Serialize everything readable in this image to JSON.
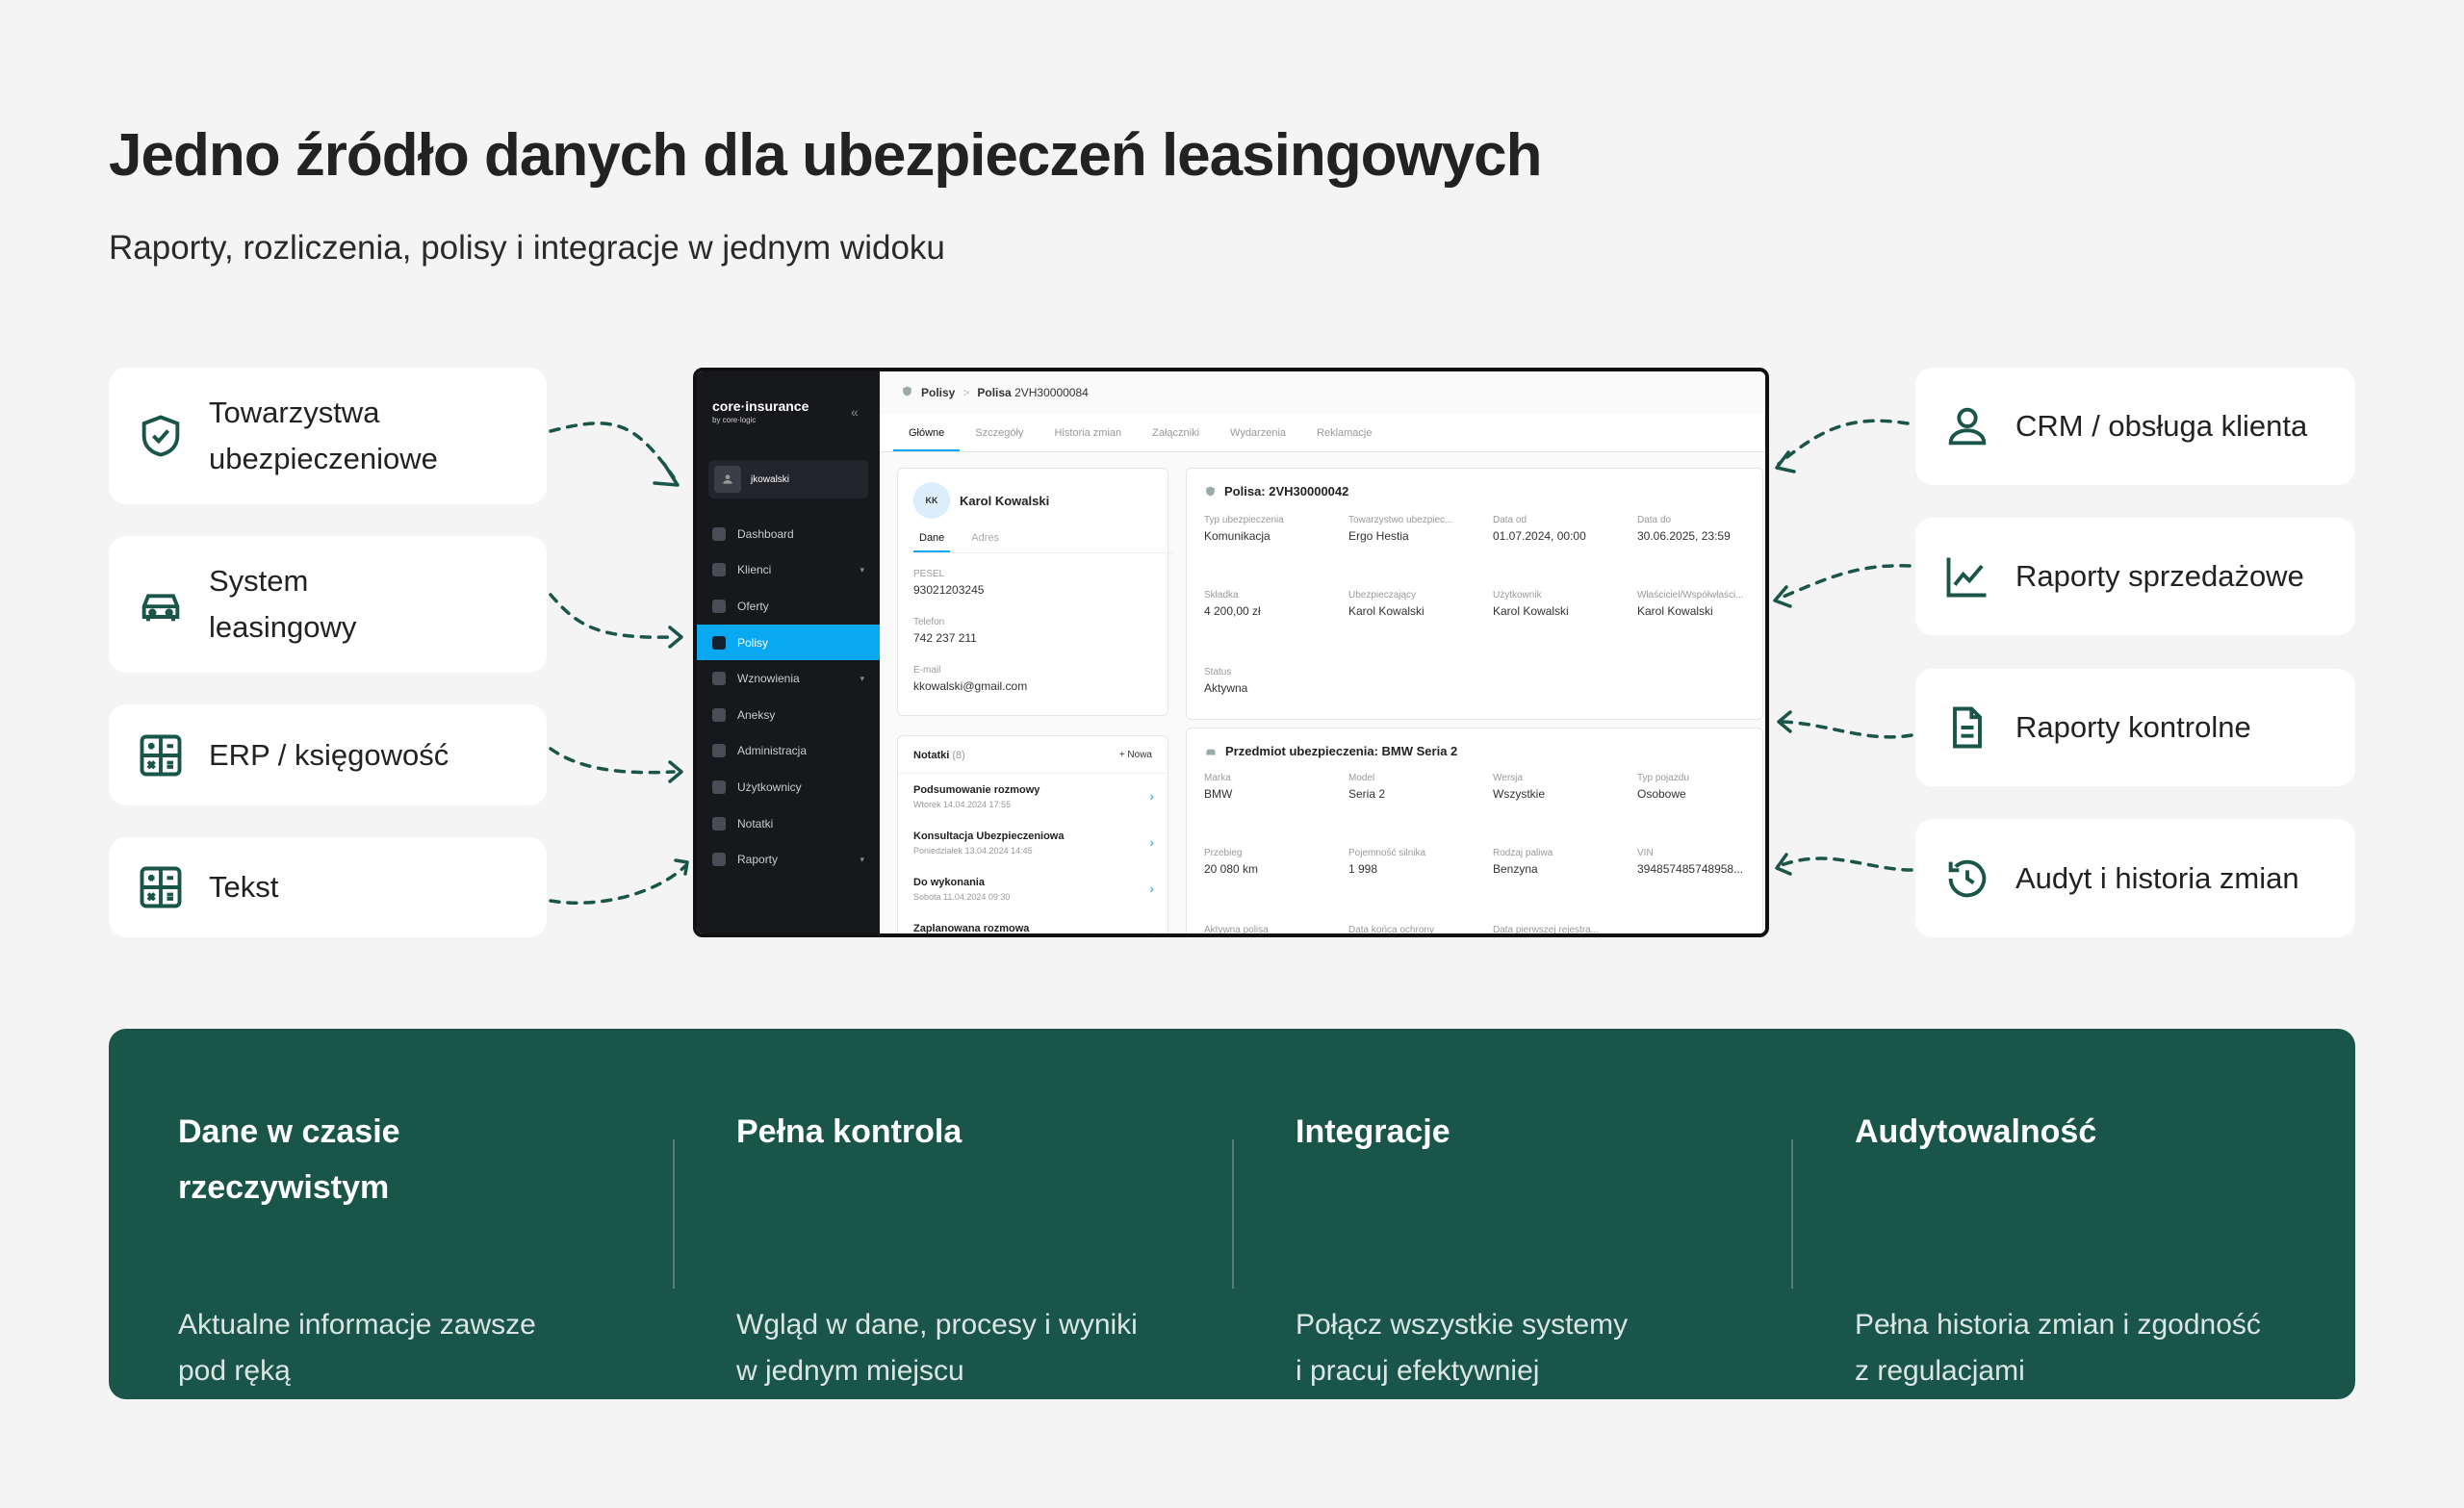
{
  "header": {
    "title": "Jedno źródło danych dla ubezpieczeń leasingowych",
    "subtitle": "Raporty, rozliczenia, polisy i integracje w jednym widoku"
  },
  "left_cards": [
    {
      "label": "Towarzystwa\nubezpieczeniowe",
      "icon": "shield-check-icon"
    },
    {
      "label": "System\nleasingowy",
      "icon": "car-icon"
    },
    {
      "label": "ERP / księgowość",
      "icon": "calculator-icon"
    },
    {
      "label": "Tekst",
      "icon": "calculator-icon"
    }
  ],
  "right_cards": [
    {
      "label": "CRM / obsługa klienta",
      "icon": "user-icon"
    },
    {
      "label": "Raporty sprzedażowe",
      "icon": "line-chart-icon"
    },
    {
      "label": "Raporty kontrolne",
      "icon": "document-icon"
    },
    {
      "label": "Audyt i historia zmian",
      "icon": "history-icon"
    }
  ],
  "app": {
    "brand": "core·insurance",
    "brand_sub": "by core·logic",
    "collapse": "«",
    "username": "jkowalski",
    "nav": [
      {
        "label": "Dashboard",
        "chevron": ""
      },
      {
        "label": "Klienci",
        "chevron": "▾"
      },
      {
        "label": "Oferty",
        "chevron": ""
      },
      {
        "label": "Polisy",
        "chevron": ""
      },
      {
        "label": "Wznowienia",
        "chevron": "▾"
      },
      {
        "label": "Aneksy",
        "chevron": ""
      },
      {
        "label": "Administracja",
        "chevron": ""
      },
      {
        "label": "Użytkownicy",
        "chevron": ""
      },
      {
        "label": "Notatki",
        "chevron": ""
      },
      {
        "label": "Raporty",
        "chevron": "▾"
      }
    ],
    "active_nav": "Polisy",
    "breadcrumb": {
      "root": "Polisy",
      "sep": ">",
      "current_label": "Polisa",
      "current_value": "2VH30000084"
    },
    "tabs": [
      "Główne",
      "Szczegóły",
      "Historia zmian",
      "Załączniki",
      "Wydarzenia",
      "Reklamacje"
    ],
    "client": {
      "initials": "KK",
      "name": "Karol Kowalski",
      "subtabs": [
        "Dane",
        "Adres"
      ],
      "fields": [
        {
          "label": "PESEL",
          "value": "93021203245"
        },
        {
          "label": "Telefon",
          "value": "742 237 211"
        },
        {
          "label": "E-mail",
          "value": "kkowalski@gmail.com"
        }
      ]
    },
    "notes": {
      "title": "Notatki",
      "count": "(8)",
      "new_label": "+ Nowa",
      "items": [
        {
          "title": "Podsumowanie rozmowy",
          "date": "Wtorek 14.04.2024 17:55"
        },
        {
          "title": "Konsultacja Ubezpieczeniowa",
          "date": "Poniedziałek 13.04.2024 14:45"
        },
        {
          "title": "Do wykonania",
          "date": "Sobota 11.04.2024 09:30"
        },
        {
          "title": "Zaplanowana rozmowa",
          "date": ""
        }
      ]
    },
    "policy": {
      "title": "Polisa: 2VH30000042",
      "rows": [
        [
          {
            "label": "Typ ubezpieczenia",
            "value": "Komunikacja"
          },
          {
            "label": "Towarzystwo ubezpiec...",
            "value": "Ergo Hestia"
          },
          {
            "label": "Data od",
            "value": "01.07.2024, 00:00"
          },
          {
            "label": "Data do",
            "value": "30.06.2025, 23:59"
          }
        ],
        [
          {
            "label": "Składka",
            "value": "4 200,00 zł"
          },
          {
            "label": "Ubezpieczający",
            "value": "Karol Kowalski"
          },
          {
            "label": "Użytkownik",
            "value": "Karol Kowalski"
          },
          {
            "label": "Właściciel/Współwłaści...",
            "value": "Karol Kowalski"
          }
        ],
        [
          {
            "label": "Status",
            "value": "Aktywna"
          }
        ]
      ]
    },
    "subject": {
      "title": "Przedmiot ubezpieczenia: BMW Seria 2",
      "rows": [
        [
          {
            "label": "Marka",
            "value": "BMW"
          },
          {
            "label": "Model",
            "value": "Seria 2"
          },
          {
            "label": "Wersja",
            "value": "Wszystkie"
          },
          {
            "label": "Typ pojazdu",
            "value": "Osobowe"
          }
        ],
        [
          {
            "label": "Przebieg",
            "value": "20 080 km"
          },
          {
            "label": "Pojemność silnika",
            "value": "1 998"
          },
          {
            "label": "Rodzaj paliwa",
            "value": "Benzyna"
          },
          {
            "label": "VIN",
            "value": "394857485748958..."
          }
        ],
        [
          {
            "label": "Aktywna polisa",
            "value": ""
          },
          {
            "label": "Data końca ochrony",
            "value": ""
          },
          {
            "label": "Data pierwszej rejestra...",
            "value": ""
          }
        ]
      ]
    }
  },
  "features": [
    {
      "title": "Dane w czasie\nrzeczywistym",
      "desc": "Aktualne informacje zawsze\npod ręką"
    },
    {
      "title": "Pełna kontrola",
      "desc": "Wgląd w dane, procesy i wyniki\nw jednym miejscu"
    },
    {
      "title": "Integracje",
      "desc": "Połącz wszystkie systemy\ni pracuj efektywniej"
    },
    {
      "title": "Audytowalność",
      "desc": "Pełna historia zmian i zgodność\nz regulacjami"
    }
  ],
  "colors": {
    "accent": "#1a5549",
    "active_nav": "#0aa8f0",
    "sidebar": "#17181c",
    "background": "#f4f4f4"
  }
}
